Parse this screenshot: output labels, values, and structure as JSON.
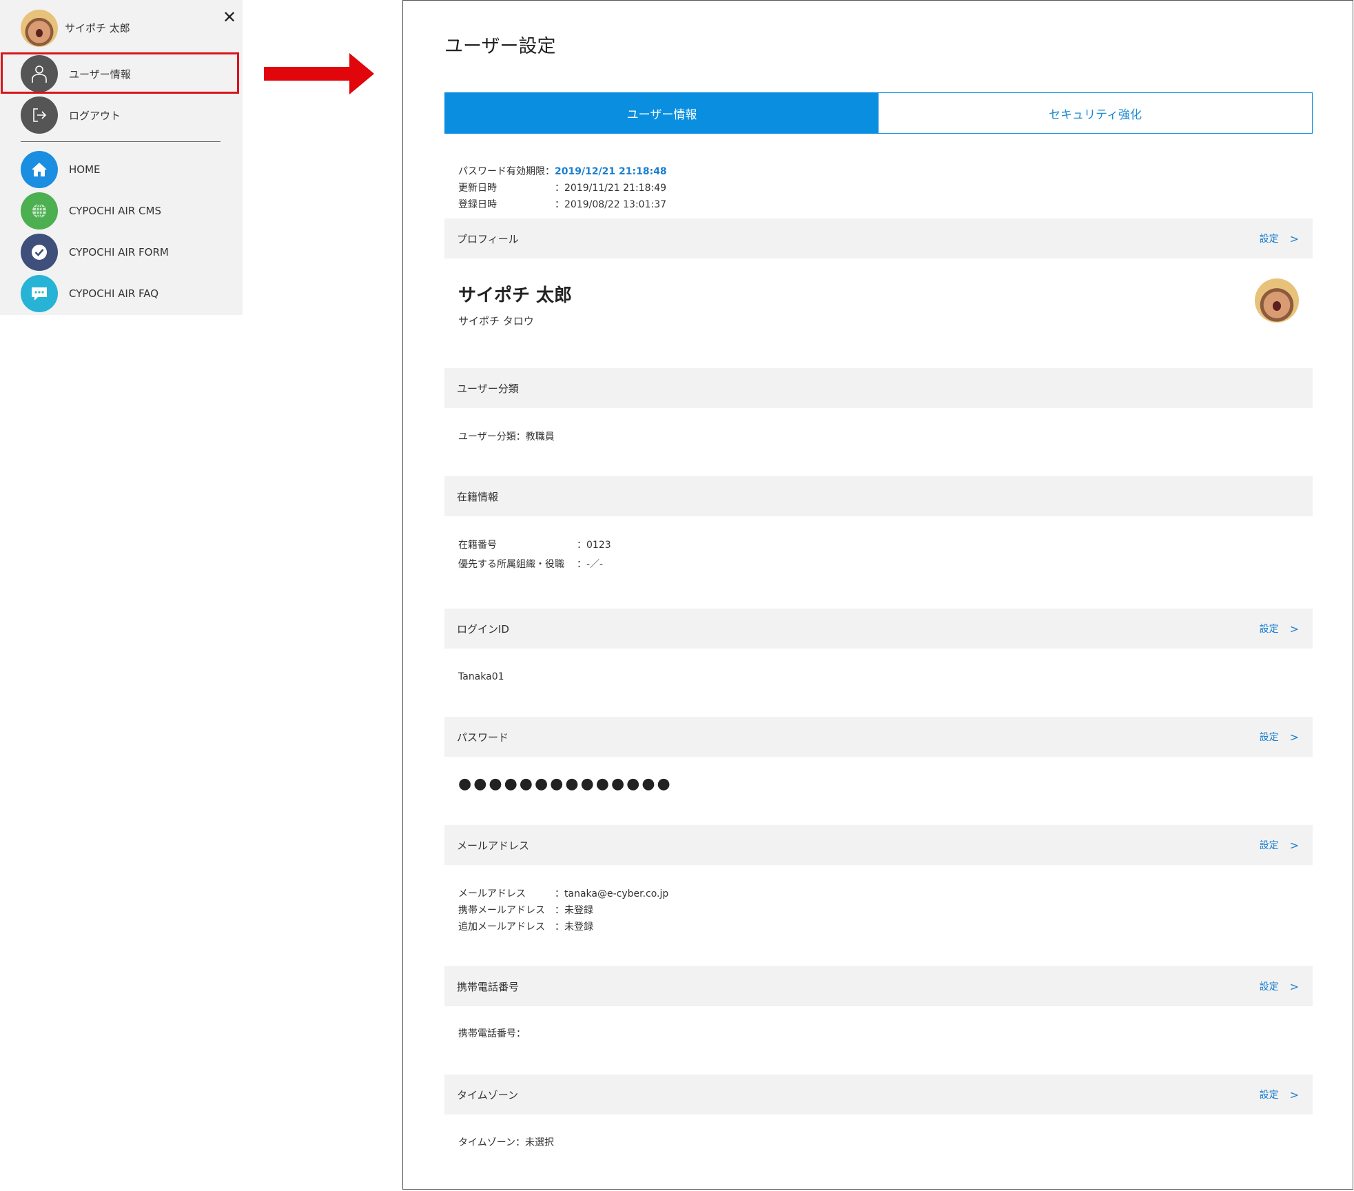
{
  "menu": {
    "user_name": "サイポチ 太郎",
    "close_glyph": "✕",
    "items": [
      {
        "label": "ユーザー情報",
        "icon": "user-icon",
        "color": "#555555"
      },
      {
        "label": "ログアウト",
        "icon": "logout-icon",
        "color": "#555555"
      },
      {
        "label": "HOME",
        "icon": "home-icon",
        "color": "#1a8ee0"
      },
      {
        "label": "CYPOCHI AIR CMS",
        "icon": "globe-icon",
        "color": "#4caf50"
      },
      {
        "label": "CYPOCHI AIR FORM",
        "icon": "check-icon",
        "color": "#3d4f7a"
      },
      {
        "label": "CYPOCHI AIR FAQ",
        "icon": "chat-icon",
        "color": "#27b3d6"
      }
    ],
    "highlight_color": "#d9141b"
  },
  "arrow_color": "#e0060b",
  "panel": {
    "title": "ユーザー設定",
    "tabs": [
      {
        "label": "ユーザー情報",
        "active": true
      },
      {
        "label": "セキュリティ強化",
        "active": false
      }
    ],
    "accent_color": "#0a8fe0",
    "meta": [
      {
        "key": "パスワード有効期限：",
        "value": "2019/12/21 21:18:48"
      },
      {
        "key": "更新日時",
        "value": "：2019/11/21 21:18:49"
      },
      {
        "key": "登録日時",
        "value": "：2019/08/22 13:01:37"
      }
    ],
    "setting_label": "設定",
    "chevron": ">",
    "sections": {
      "profile": {
        "title": "プロフィール",
        "name": "サイポチ 太郎",
        "kana": "サイポチ タロウ"
      },
      "user_category": {
        "title": "ユーザー分類",
        "text": "ユーザー分類：教職員"
      },
      "enrollment": {
        "title": "在籍情報",
        "rows": [
          {
            "key": "在籍番号",
            "value": "：0123"
          },
          {
            "key": "優先する所属組織・役職",
            "value": "：-／-"
          }
        ]
      },
      "login_id": {
        "title": "ログインID",
        "text": "Tanaka01"
      },
      "password": {
        "title": "パスワード",
        "masked": "●●●●●●●●●●●●●●"
      },
      "email": {
        "title": "メールアドレス",
        "rows": [
          {
            "key": "メールアドレス",
            "value": "：tanaka@e-cyber.co.jp"
          },
          {
            "key": "携帯メールアドレス",
            "value": "：未登録"
          },
          {
            "key": "追加メールアドレス",
            "value": "：未登録"
          }
        ]
      },
      "mobile": {
        "title": "携帯電話番号",
        "text": "携帯電話番号："
      },
      "timezone": {
        "title": "タイムゾーン",
        "text": "タイムゾーン：未選択"
      }
    }
  }
}
